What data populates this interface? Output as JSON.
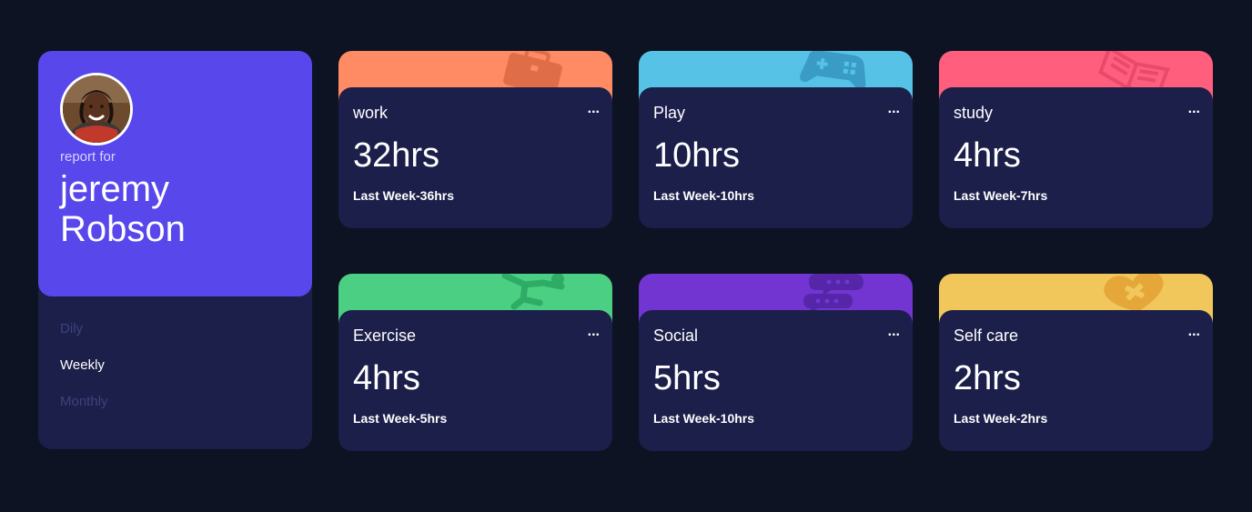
{
  "profile": {
    "report_for": "report for",
    "name": "jeremy Robson"
  },
  "periods": [
    {
      "label": "Dily",
      "active": false
    },
    {
      "label": "Weekly",
      "active": true
    },
    {
      "label": "Monthly",
      "active": false
    }
  ],
  "menu_glyph": "...",
  "cards": [
    {
      "title": "work",
      "current": "32hrs",
      "previous": "Last Week-36hrs",
      "color": "#ff8b64",
      "icon": "briefcase-icon"
    },
    {
      "title": "Play",
      "current": "10hrs",
      "previous": "Last Week-10hrs",
      "color": "#55c2e6",
      "icon": "gamepad-icon"
    },
    {
      "title": "study",
      "current": "4hrs",
      "previous": "Last Week-7hrs",
      "color": "#ff5e7d",
      "icon": "book-icon"
    },
    {
      "title": "Exercise",
      "current": "4hrs",
      "previous": "Last Week-5hrs",
      "color": "#4bcf82",
      "icon": "running-icon"
    },
    {
      "title": "Social",
      "current": "5hrs",
      "previous": "Last Week-10hrs",
      "color": "#7335d2",
      "icon": "chat-icon"
    },
    {
      "title": "Self care",
      "current": "2hrs",
      "previous": "Last Week-2hrs",
      "color": "#f1c75b",
      "icon": "heart-icon"
    }
  ]
}
